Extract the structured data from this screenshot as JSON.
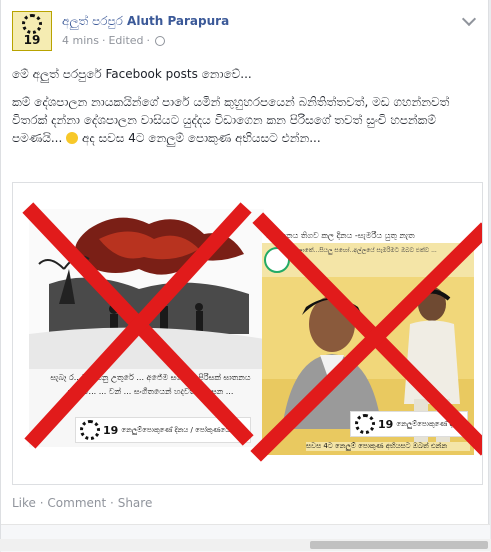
{
  "header": {
    "page_name_sinhala": "අලුත් පරපුර",
    "page_name": "Aluth Parapura",
    "time": "4 mins",
    "edited": "Edited",
    "separator": "·",
    "avatar_number": "19"
  },
  "post": {
    "line1": "මේ අලුත් පරපුරේ Facebook posts නොවේ...",
    "line2": "කම් දේශපාලන නායකයින්ගේ පාරේ යමින් කුහුහරපයෙන් බනිතිත්තවත්, මඩ ගහන්නවත් විතරක් දන්නා දේශපාලන වාසියට යුද්දය විඩාගෙන කන පිරිසගේ තවත් සුංචි හපන්කම් පමණයි...",
    "line2_tail": "අද සවස 4ට නෙලුම් පොකුණ අභියසට එන්න..."
  },
  "media": {
    "left_caption": "සැබෑ ර...වන් යනු උතුරේ ... අජේම සහෝ.. පිරිසක් ඝාතනය කල ම... ... වන් ... සංගීතයෙන් හදවත් සනසන ...",
    "left_logo_number": "19",
    "left_logo_text": "නෙලුම්පොකුණේ දිනය / පෝකුණයේ දිනය",
    "right_banner": "...ඩිතනය තිගව කල දිනය -සැමරීය යුතු නැත",
    "right_small_text": "ලොකේ...සියලු සහෝ..අල්ලයේ සැමරිමට ඔබව එක්ව ...",
    "right_logo_number": "19",
    "right_logo_text": "නෙලුම්පොකුණේ දිනය",
    "right_caption": "සවස 4ට නෙලුම් පොකුණ අභියසට ඔබත් එන්න"
  },
  "footer": {
    "like": "Like",
    "comment": "Comment",
    "share": "Share",
    "sep": "·"
  },
  "colors": {
    "link": "#3b5998",
    "meta": "#90949c",
    "cross": "#e11b1b"
  }
}
